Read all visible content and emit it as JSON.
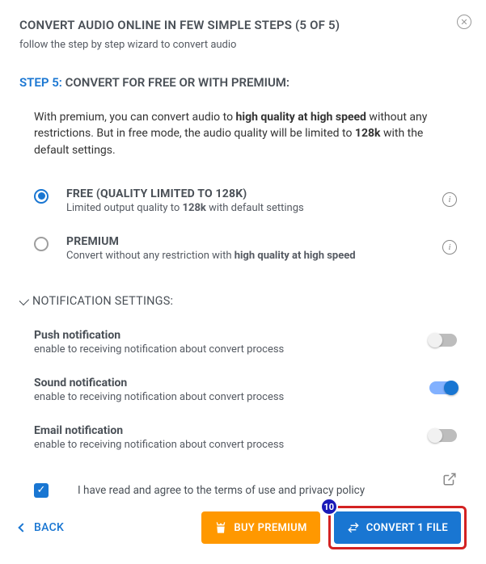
{
  "header": {
    "title": "CONVERT AUDIO ONLINE IN FEW SIMPLE STEPS (5 OF 5)",
    "subtitle": "follow the step by step wizard to convert audio"
  },
  "step": {
    "label": "STEP 5:",
    "title": "CONVERT FOR FREE OR WITH PREMIUM:"
  },
  "description": {
    "pre1": "With premium, you can convert audio to ",
    "bold1": "high quality at high speed",
    "mid": " without any restrictions. But in free mode, the audio quality will be limited to ",
    "bold2": "128k",
    "post": " with the default settings."
  },
  "plans": {
    "free": {
      "title": "FREE (QUALITY LIMITED TO 128K)",
      "sub_pre": "Limited output quality to ",
      "sub_bold": "128k",
      "sub_post": " with default settings"
    },
    "premium": {
      "title": "PREMIUM",
      "sub_pre": "Convert without any restriction with ",
      "sub_bold": "high quality at high speed"
    }
  },
  "notifications": {
    "header": "NOTIFICATION SETTINGS:",
    "push": {
      "title": "Push notification",
      "sub": "enable to receiving notification about convert process"
    },
    "sound": {
      "title": "Sound notification",
      "sub": "enable to receiving notification about convert process"
    },
    "email": {
      "title": "Email notification",
      "sub": "enable to receiving notification about convert process"
    }
  },
  "agree": {
    "text": "I have read and agree to the terms of use and privacy policy"
  },
  "footer": {
    "back": "BACK",
    "buy": "BUY PREMIUM",
    "convert": "CONVERT 1 FILE",
    "badge": "10"
  }
}
